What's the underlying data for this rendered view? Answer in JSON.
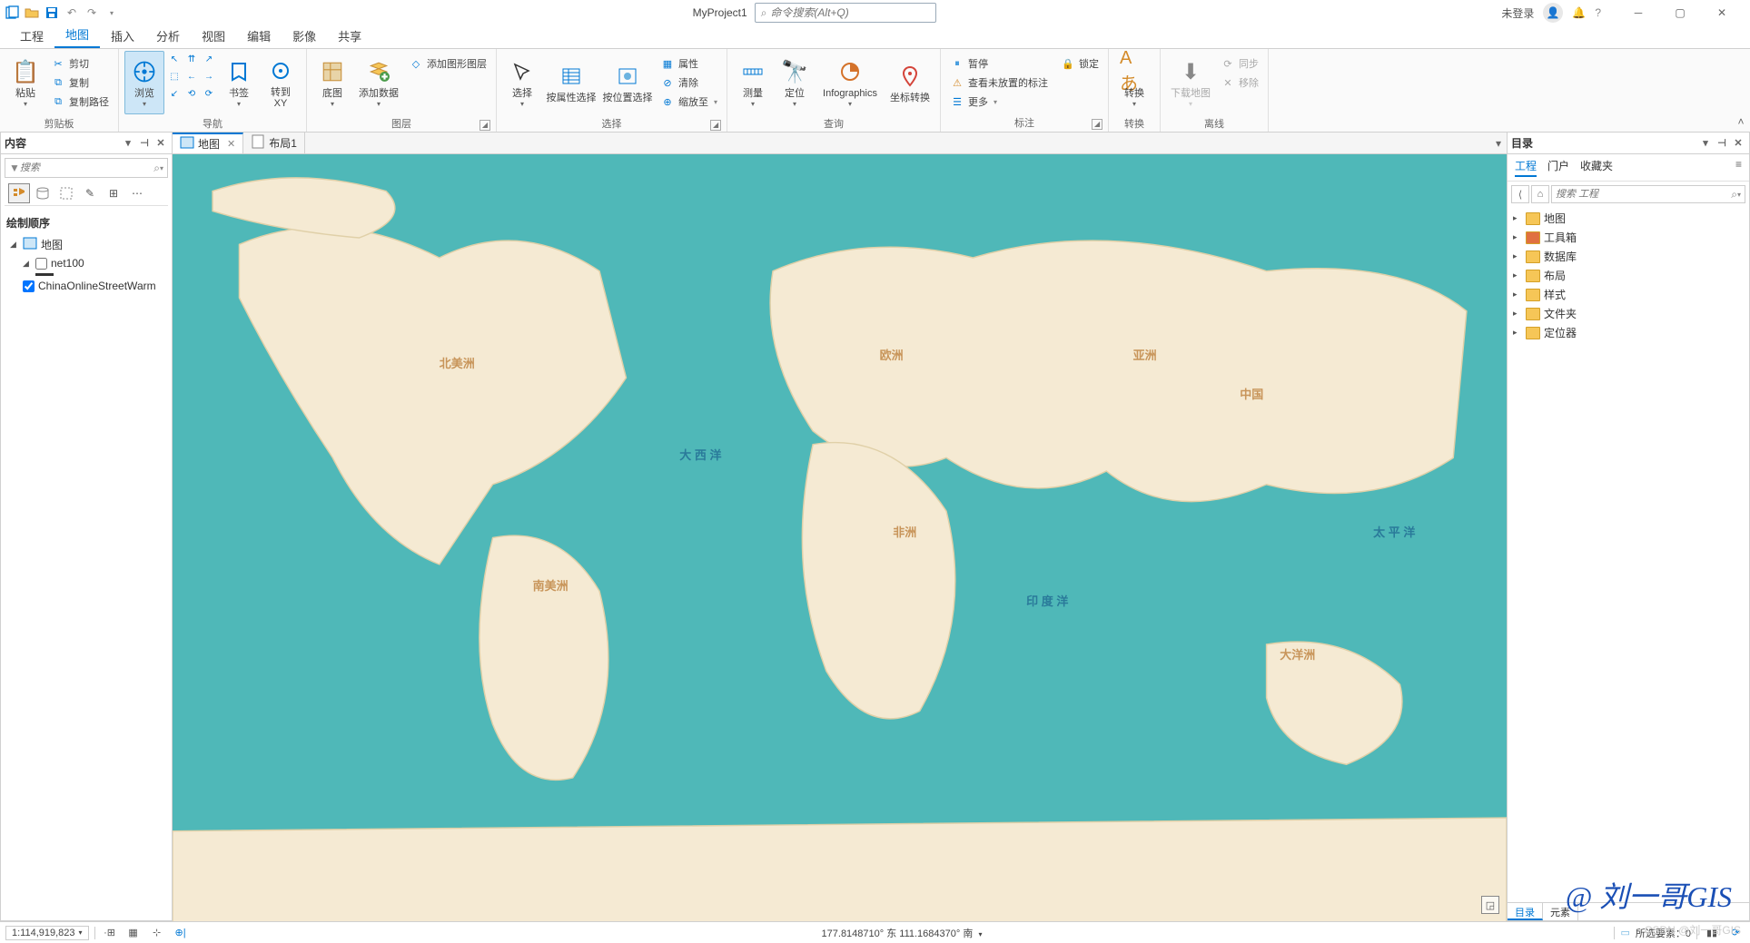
{
  "title": "MyProject1",
  "search_placeholder": "命令搜索(Alt+Q)",
  "login_status": "未登录",
  "ribbon_tabs": [
    "工程",
    "地图",
    "插入",
    "分析",
    "视图",
    "编辑",
    "影像",
    "共享"
  ],
  "ribbon_active_index": 1,
  "ribbon": {
    "clipboard": {
      "label": "剪贴板",
      "paste": "粘贴",
      "cut": "剪切",
      "copy": "复制",
      "copy_path": "复制路径"
    },
    "navigate": {
      "label": "导航",
      "explore": "浏览",
      "bookmarks": "书签",
      "goto_xy": "转到\nXY"
    },
    "layer": {
      "label": "图层",
      "basemap": "底图",
      "add_data": "添加数据",
      "add_graphics": "添加图形图层"
    },
    "selection": {
      "label": "选择",
      "select": "选择",
      "by_attr": "按属性选择",
      "by_loc": "按位置选择",
      "attributes": "属性",
      "clear": "清除",
      "zoom_to": "缩放至"
    },
    "inquiry": {
      "label": "查询",
      "measure": "测量",
      "locate": "定位",
      "infographics": "Infographics",
      "coord_conv": "坐标转换"
    },
    "labeling": {
      "label": "标注",
      "pause": "暂停",
      "lock": "锁定",
      "view_unplaced": "查看未放置的标注",
      "more": "更多"
    },
    "convert": {
      "label": "转换",
      "btn": "转换"
    },
    "offline": {
      "label": "离线",
      "download": "下载地图",
      "sync": "同步",
      "remove": "移除"
    }
  },
  "contents": {
    "title": "内容",
    "search_placeholder": "搜索",
    "section": "绘制顺序",
    "map_name": "地图",
    "layers": [
      {
        "name": "net100",
        "checked": false
      },
      {
        "name": "ChinaOnlineStreetWarm",
        "checked": true
      }
    ]
  },
  "view_tabs": [
    {
      "label": "地图",
      "active": true
    },
    {
      "label": "布局1",
      "active": false
    }
  ],
  "map_labels": {
    "north_america": "北美洲",
    "south_america": "南美洲",
    "europe": "欧洲",
    "africa": "非洲",
    "asia": "亚洲",
    "china": "中国",
    "oceania": "大洋洲",
    "atlantic": "大 西 洋",
    "indian_ocean": "印 度 洋",
    "pacific": "太 平 洋"
  },
  "catalog": {
    "title": "目录",
    "tabs": [
      "工程",
      "门户",
      "收藏夹"
    ],
    "active_tab": 0,
    "search_placeholder": "搜索 工程",
    "nodes": [
      "地图",
      "工具箱",
      "数据库",
      "布局",
      "样式",
      "文件夹",
      "定位器"
    ],
    "bottom_tabs": [
      "目录",
      "元素"
    ],
    "bottom_active": 0
  },
  "status": {
    "scale": "1:114,919,823",
    "coords": "177.8148710° 东 111.1684370° 南",
    "selected": "所选要素：0"
  },
  "watermark": "@ 刘一哥GIS",
  "csdn": "CSDN @刘一哥GIS"
}
